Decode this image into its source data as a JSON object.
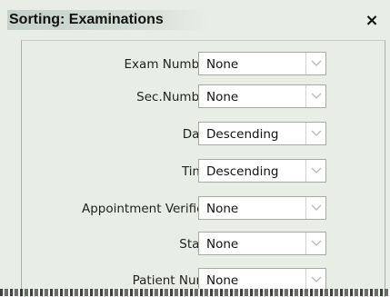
{
  "dialog": {
    "title": "Sorting: Examinations",
    "close_glyph": "×"
  },
  "rows": [
    {
      "label": "Exam Number",
      "value": "None"
    },
    {
      "label": "Sec.Number",
      "value": "None"
    },
    {
      "label": "Date",
      "value": "Descending"
    },
    {
      "label": "Time",
      "value": "Descending"
    },
    {
      "label": "Appointment Verified",
      "value": "None"
    },
    {
      "label": "State",
      "value": "None"
    },
    {
      "label": "Patient Num.",
      "value": "None"
    }
  ],
  "icons": {
    "dropdown": "chevron-down-icon",
    "close": "close-icon"
  },
  "colors": {
    "background": "#e8eee5",
    "select_bg": "#ffffff",
    "text": "#222222"
  }
}
